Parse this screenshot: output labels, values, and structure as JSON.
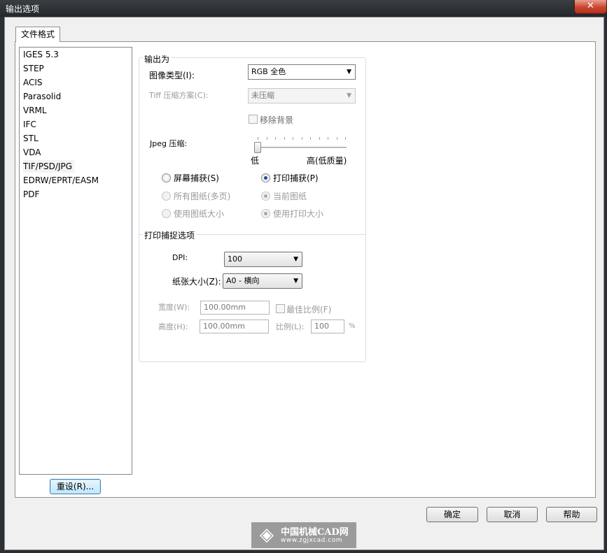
{
  "window": {
    "title": "输出选项",
    "close_glyph": "✕"
  },
  "tab": {
    "label": "文件格式"
  },
  "formats": [
    "IGES 5.3",
    "STEP",
    "ACIS",
    "Parasolid",
    "VRML",
    "IFC",
    "STL",
    "VDA",
    "TIF/PSD/JPG",
    "EDRW/EPRT/EASM",
    "PDF"
  ],
  "selected_format": "TIF/PSD/JPG",
  "reset_button": "重设(R)...",
  "output_as": {
    "title": "输出为",
    "image_type_label": "图像类型(I):",
    "image_type_value": "RGB 全色",
    "tiff_label": "Tiff 压缩方案(C):",
    "tiff_value": "未压缩",
    "remove_bg_label": "移除背景",
    "jpeg_label": "Jpeg 压缩:",
    "jpeg_low": "低",
    "jpeg_high": "高(低质量)",
    "jpeg_level": 0,
    "screen_capture": "屏幕捕获(S)",
    "print_capture": "打印捕获(P)",
    "all_sheets": "所有图纸(多页)",
    "current_sheet": "当前图纸",
    "use_sheet_size": "使用图纸大小",
    "use_print_size": "使用打印大小"
  },
  "print_options": {
    "title": "打印捕捉选项",
    "dpi_label": "DPI:",
    "dpi_value": "100",
    "paper_label": "纸张大小(Z):",
    "paper_value": "A0 - 横向",
    "width_label": "宽度(W):",
    "width_value": "100.00mm",
    "height_label": "高度(H):",
    "height_value": "100.00mm",
    "best_fit_label": "最佳比例(F)",
    "scale_label": "比例(L):",
    "scale_value": "100",
    "percent": "%"
  },
  "buttons": {
    "ok": "确定",
    "cancel": "取消",
    "help": "帮助"
  },
  "watermark": {
    "name": "中国机械CAD网",
    "url": "www.zgjxcad.com"
  }
}
